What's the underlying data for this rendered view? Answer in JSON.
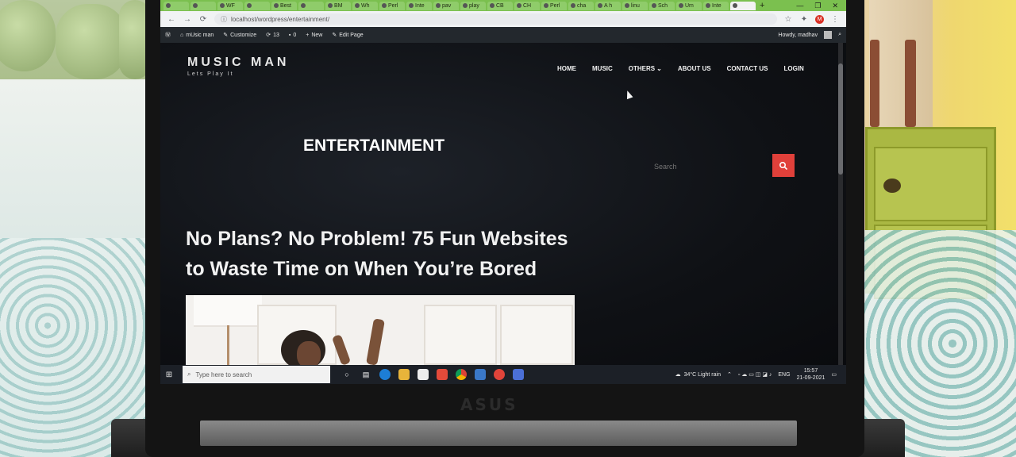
{
  "browser": {
    "tabs": [
      "",
      "",
      "WF",
      "",
      "Best",
      "",
      "BM",
      "Wh",
      "Perl",
      "Inte",
      "pav",
      "play",
      "CB",
      "CH",
      "Perl",
      "cha",
      "A h",
      "linu",
      "Sch",
      "Um",
      "Inte",
      ""
    ],
    "url": "localhost/wordpress/entertainment/",
    "profile_initial": "M",
    "window_controls": [
      "—",
      "❐",
      "✕"
    ]
  },
  "adminbar": {
    "site_name": "mUsic man",
    "customize": "Customize",
    "updates_count": "13",
    "comments_count": "0",
    "new": "New",
    "edit_page": "Edit Page",
    "howdy": "Howdy, madhav"
  },
  "site": {
    "brand_title": "MUSIC MAN",
    "brand_tagline": "Lets Play It",
    "menu": [
      "HOME",
      "MUSIC",
      "OTHERS",
      "ABOUT US",
      "CONTACT US",
      "LOGIN"
    ],
    "page_title": "ENTERTAINMENT",
    "search_placeholder": "Search",
    "post_title": "No Plans? No Problem! 75 Fun Websites to Waste Time on When You’re Bored"
  },
  "taskbar": {
    "search_placeholder": "Type here to search",
    "weather": "34°C  Light rain",
    "language": "ENG",
    "time": "15:57",
    "date": "21-09-2021"
  },
  "colors": {
    "accent_search_button": "#e0403a",
    "tab_strip": "#7bc04f",
    "admin_bar": "#23282d"
  },
  "laptop": {
    "brand_mark": "ASUS"
  }
}
